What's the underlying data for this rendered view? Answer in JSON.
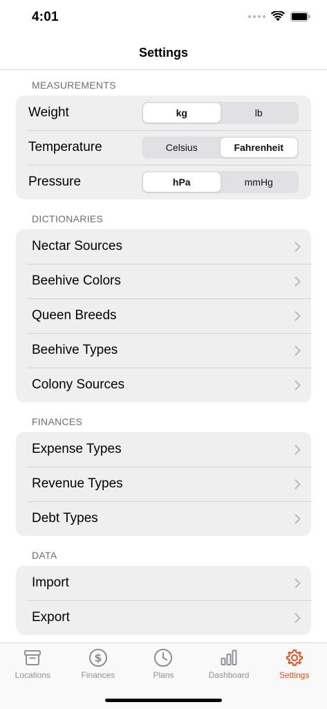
{
  "status": {
    "time": "4:01"
  },
  "nav": {
    "title": "Settings"
  },
  "colors": {
    "accent": "#e0501f",
    "inactive": "#8e8e93"
  },
  "sections": {
    "measurements": {
      "header": "MEASUREMENTS",
      "rows": [
        {
          "label": "Weight",
          "options": [
            "kg",
            "lb"
          ],
          "selected": "kg"
        },
        {
          "label": "Temperature",
          "options": [
            "Celsius",
            "Fahrenheit"
          ],
          "selected": "Fahrenheit"
        },
        {
          "label": "Pressure",
          "options": [
            "hPa",
            "mmHg"
          ],
          "selected": "hPa"
        }
      ]
    },
    "dictionaries": {
      "header": "DICTIONARIES",
      "items": [
        "Nectar Sources",
        "Beehive Colors",
        "Queen Breeds",
        "Beehive Types",
        "Colony Sources"
      ]
    },
    "finances": {
      "header": "FINANCES",
      "items": [
        "Expense Types",
        "Revenue Types",
        "Debt Types"
      ]
    },
    "data": {
      "header": "DATA",
      "items": [
        "Import",
        "Export"
      ]
    }
  },
  "tabs": [
    {
      "label": "Locations",
      "icon": "archive-box-icon",
      "active": false
    },
    {
      "label": "Finances",
      "icon": "dollar-circle-icon",
      "active": false
    },
    {
      "label": "Plans",
      "icon": "clock-icon",
      "active": false
    },
    {
      "label": "Dashboard",
      "icon": "bar-chart-icon",
      "active": false
    },
    {
      "label": "Settings",
      "icon": "gear-icon",
      "active": true
    }
  ]
}
